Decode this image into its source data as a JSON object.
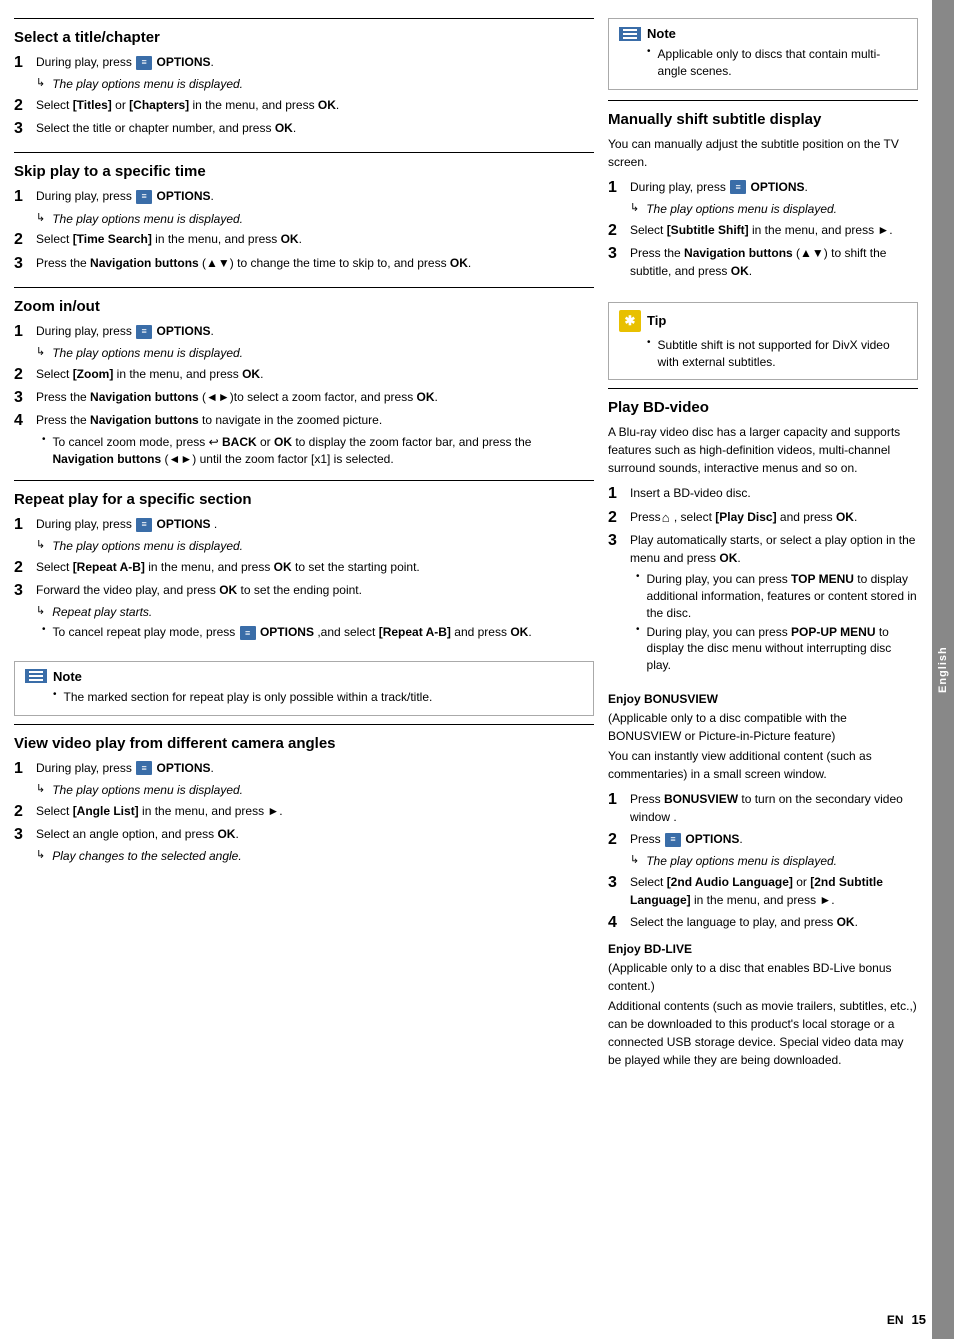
{
  "sidetab": {
    "label": "English"
  },
  "footer": {
    "en": "EN",
    "page": "15"
  },
  "sections": {
    "select_title": {
      "title": "Select a title/chapter",
      "steps": [
        {
          "num": "1",
          "text": "During play, press",
          "icon": "options",
          "text2": "OPTIONS.",
          "sub": "The play options menu is displayed."
        },
        {
          "num": "2",
          "text": "Select [Titles] or [Chapters] in the menu, and press OK."
        },
        {
          "num": "3",
          "text": "Select the title or chapter number, and press OK."
        }
      ]
    },
    "skip_play": {
      "title": "Skip play to a specific time",
      "steps": [
        {
          "num": "1",
          "text": "During play, press",
          "icon": "options",
          "text2": "OPTIONS.",
          "sub": "The play options menu is displayed."
        },
        {
          "num": "2",
          "text": "Select [Time Search] in the menu, and press OK."
        },
        {
          "num": "3",
          "text_before": "Press the ",
          "bold": "Navigation buttons",
          "text_sym": " (▲▼)",
          "text_after": " to change the time to skip to, and press OK."
        }
      ]
    },
    "zoom": {
      "title": "Zoom in/out",
      "steps": [
        {
          "num": "1",
          "text": "During play, press",
          "icon": "options",
          "text2": "OPTIONS.",
          "sub": "The play options menu is displayed."
        },
        {
          "num": "2",
          "text": "Select [Zoom] in the menu, and press OK."
        },
        {
          "num": "3",
          "text_before": "Press the ",
          "bold": "Navigation buttons",
          "text_sym": " (◄►)",
          "text_after": "to select a zoom factor, and press OK."
        },
        {
          "num": "4",
          "text_before": "Press the ",
          "bold": "Navigation buttons",
          "text_after": " to navigate in the zoomed picture.",
          "bullets": [
            "To cancel zoom mode, press ↩ BACK or OK to display the zoom factor bar, and press the Navigation buttons (◄►) until the zoom factor [x1] is selected."
          ]
        }
      ]
    },
    "repeat_play": {
      "title": "Repeat play for a specific section",
      "steps": [
        {
          "num": "1",
          "text": "During play, press",
          "icon": "options",
          "text2": "OPTIONS .",
          "sub": "The play options menu is displayed."
        },
        {
          "num": "2",
          "text": "Select [Repeat A-B] in the menu, and press OK to set the starting point."
        },
        {
          "num": "3",
          "text": "Forward the video play, and press OK to set the ending point.",
          "subs": [
            "Repeat play starts.",
            "To cancel repeat play mode, press"
          ],
          "sub_icon": true,
          "sub_after": "OPTIONS ,and select [Repeat A-B] and press OK."
        }
      ]
    },
    "note_repeat": {
      "text": "The marked section for repeat play is only possible within a track/title."
    },
    "camera_angles": {
      "title": "View video play from different camera angles",
      "steps": [
        {
          "num": "1",
          "text": "During play, press",
          "icon": "options",
          "text2": "OPTIONS.",
          "sub": "The play options menu is displayed."
        },
        {
          "num": "2",
          "text": "Select [Angle List] in the menu, and press ►."
        },
        {
          "num": "3",
          "text": "Select an angle option, and press OK.",
          "sub": "Play changes to the selected angle."
        }
      ]
    }
  },
  "right_sections": {
    "note_multi": {
      "text": "Applicable only to discs that contain multi-angle scenes."
    },
    "subtitle_display": {
      "title": "Manually shift subtitle display",
      "intro": "You can manually adjust the subtitle position on the TV screen.",
      "steps": [
        {
          "num": "1",
          "text": "During play, press",
          "icon": "options",
          "text2": "OPTIONS.",
          "sub": "The play options menu is displayed."
        },
        {
          "num": "2",
          "text": "Select [Subtitle Shift] in the menu, and press ►."
        },
        {
          "num": "3",
          "text_before": "Press the ",
          "bold": "Navigation buttons",
          "text_sym": " (▲▼)",
          "text_after": " to shift the subtitle, and press OK."
        }
      ]
    },
    "tip_subtitle": {
      "text": "Subtitle shift is not supported for DivX video with external subtitles."
    },
    "bd_video": {
      "title": "Play BD-video",
      "intro": "A Blu-ray video disc has a larger capacity and supports features such as high-definition videos, multi-channel surround sounds, interactive menus and so on.",
      "steps": [
        {
          "num": "1",
          "text": "Insert a BD-video disc."
        },
        {
          "num": "2",
          "text_before": "Press",
          "home": true,
          "text_after": ", select [Play Disc] and press OK."
        },
        {
          "num": "3",
          "text": "Play automatically starts, or select a play option in the menu and press OK.",
          "bullets": [
            "During play, you can press TOP MENU to display additional information, features or content stored in the disc.",
            "During play, you can press POP-UP MENU to display the disc menu without interrupting disc play."
          ]
        }
      ]
    },
    "bonusview": {
      "subtitle": "Enjoy BONUSVIEW",
      "intro1": "(Applicable only to a disc compatible with the BONUSVIEW or Picture-in-Picture feature)",
      "intro2": "You can instantly view additional content (such as commentaries) in a small screen window.",
      "steps": [
        {
          "num": "1",
          "text_before": "Press ",
          "bold": "BONUSVIEW",
          "text_after": " to turn on the secondary video window ."
        },
        {
          "num": "2",
          "text": "Press",
          "icon": "options",
          "text2": "OPTIONS.",
          "sub": "The play options menu is displayed."
        },
        {
          "num": "3",
          "text": "Select [2nd Audio Language] or [2nd Subtitle Language] in the menu, and press ►."
        },
        {
          "num": "4",
          "text": "Select the language to play, and press OK."
        }
      ]
    },
    "bd_live": {
      "subtitle": "Enjoy BD-LIVE",
      "intro1": "(Applicable only to a disc that enables BD-Live bonus content.)",
      "intro2": "Additional contents (such as movie trailers, subtitles, etc.,) can be downloaded to this product's local storage or a connected USB storage device. Special video data may be played while they are being downloaded."
    }
  }
}
